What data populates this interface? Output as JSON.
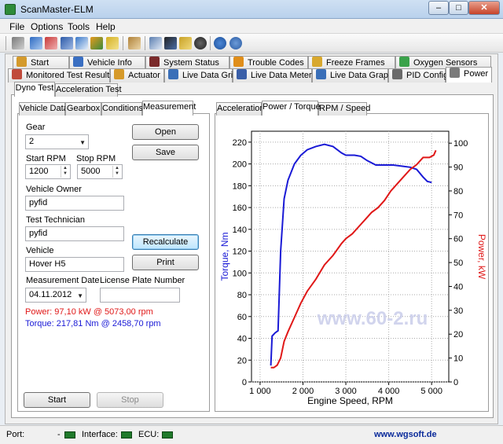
{
  "window": {
    "title": "ScanMaster-ELM",
    "minimize": "–",
    "maximize": "□",
    "close": "✕"
  },
  "menu": [
    "File",
    "Options",
    "Tools",
    "Help"
  ],
  "toolbar_icons": [
    "connect-icon",
    "wizard-icon",
    "diagnostics-icon",
    "monitor-icon",
    "chart-icon",
    "grid-icon",
    "dollar-icon",
    "clipboard-icon",
    "message-icon",
    "terminal-icon",
    "battery-icon",
    "globe-icon",
    "info-icon",
    "help-icon"
  ],
  "tabs_row1": [
    "Start",
    "Vehicle Info",
    "System Status",
    "Trouble Codes",
    "Freeze Frames",
    "Oxygen Sensors"
  ],
  "tabs_row2": [
    "Monitored Test Results",
    "Actuator",
    "Live Data Grid",
    "Live Data Meter",
    "Live Data Graph",
    "PID Config",
    "Power"
  ],
  "subtabs": [
    "Dyno Test",
    "Acceleration Test"
  ],
  "left_tabs": [
    "Vehicle Data",
    "Gearbox",
    "Conditions",
    "Measurement"
  ],
  "right_tabs": [
    "Acceleration",
    "Power / Torque",
    "RPM / Speed"
  ],
  "form": {
    "gear_label": "Gear",
    "gear_value": "2",
    "start_rpm_label": "Start RPM",
    "start_rpm": "1200",
    "stop_rpm_label": "Stop RPM",
    "stop_rpm": "5000",
    "owner_label": "Vehicle Owner",
    "owner": "pyfid",
    "technician_label": "Test Technician",
    "technician": "pyfid",
    "vehicle_label": "Vehicle",
    "vehicle": "Hover H5",
    "date_label": "Measurement Date",
    "date": "04.11.2012",
    "plate_label": "License Plate Number",
    "plate": "",
    "power_result": "Power: 97,10 kW @ 5073,00 rpm",
    "torque_result": "Torque: 217,81 Nm @ 2458,70 rpm"
  },
  "buttons": {
    "open": "Open",
    "save": "Save",
    "recalculate": "Recalculate",
    "print": "Print",
    "start": "Start",
    "stop": "Stop"
  },
  "status": {
    "port": "Port:",
    "port_value": "-",
    "interface": "Interface:",
    "ecu": "ECU:",
    "link": "www.wgsoft.de"
  },
  "watermark": "www.60-2.ru",
  "colors": {
    "torque": "#1a1ad6",
    "power": "#e01818",
    "accent": "#0a2a9a"
  },
  "chart_data": {
    "type": "line",
    "xlabel": "Engine Speed, RPM",
    "ylabel_left": "Torque, Nm",
    "ylabel_right": "Power, kW",
    "xlim": [
      800,
      5400
    ],
    "ylim_left": [
      0,
      230
    ],
    "ylim_right": [
      0,
      105
    ],
    "x_ticks": [
      "1 000",
      "2 000",
      "3 000",
      "4 000",
      "5 000"
    ],
    "y_ticks_left": [
      "0",
      "20",
      "40",
      "60",
      "80",
      "100",
      "120",
      "140",
      "160",
      "180",
      "200",
      "220"
    ],
    "y_ticks_right": [
      "0",
      "10",
      "20",
      "30",
      "40",
      "50",
      "60",
      "70",
      "80",
      "90",
      "100"
    ],
    "grid": true,
    "series": [
      {
        "axis": "left",
        "values": [
          [
            1250,
            15
          ],
          [
            1280,
            42
          ],
          [
            1350,
            45
          ],
          [
            1420,
            47
          ],
          [
            1480,
            120
          ],
          [
            1560,
            168
          ],
          [
            1650,
            185
          ],
          [
            1800,
            200
          ],
          [
            1950,
            208
          ],
          [
            2100,
            213
          ],
          [
            2300,
            216
          ],
          [
            2500,
            218
          ],
          [
            2700,
            216
          ],
          [
            2900,
            210
          ],
          [
            3000,
            208
          ],
          [
            3200,
            208
          ],
          [
            3350,
            207
          ],
          [
            3500,
            203
          ],
          [
            3700,
            199
          ],
          [
            3900,
            199
          ],
          [
            4100,
            199
          ],
          [
            4300,
            198
          ],
          [
            4500,
            197
          ],
          [
            4650,
            195
          ],
          [
            4800,
            188
          ],
          [
            4900,
            184
          ],
          [
            5000,
            183
          ]
        ]
      },
      {
        "axis": "right",
        "values": [
          [
            1250,
            6
          ],
          [
            1320,
            6
          ],
          [
            1400,
            7
          ],
          [
            1480,
            10
          ],
          [
            1560,
            17
          ],
          [
            1650,
            21
          ],
          [
            1800,
            27
          ],
          [
            1950,
            33
          ],
          [
            2100,
            38
          ],
          [
            2300,
            43
          ],
          [
            2500,
            49
          ],
          [
            2700,
            53
          ],
          [
            2900,
            58
          ],
          [
            3000,
            60
          ],
          [
            3150,
            62
          ],
          [
            3300,
            65
          ],
          [
            3450,
            68
          ],
          [
            3600,
            71
          ],
          [
            3750,
            73
          ],
          [
            3900,
            76
          ],
          [
            4050,
            80
          ],
          [
            4200,
            83
          ],
          [
            4350,
            86
          ],
          [
            4500,
            89
          ],
          [
            4650,
            91
          ],
          [
            4800,
            94
          ],
          [
            4950,
            94
          ],
          [
            5050,
            95
          ],
          [
            5100,
            97
          ]
        ]
      }
    ]
  }
}
